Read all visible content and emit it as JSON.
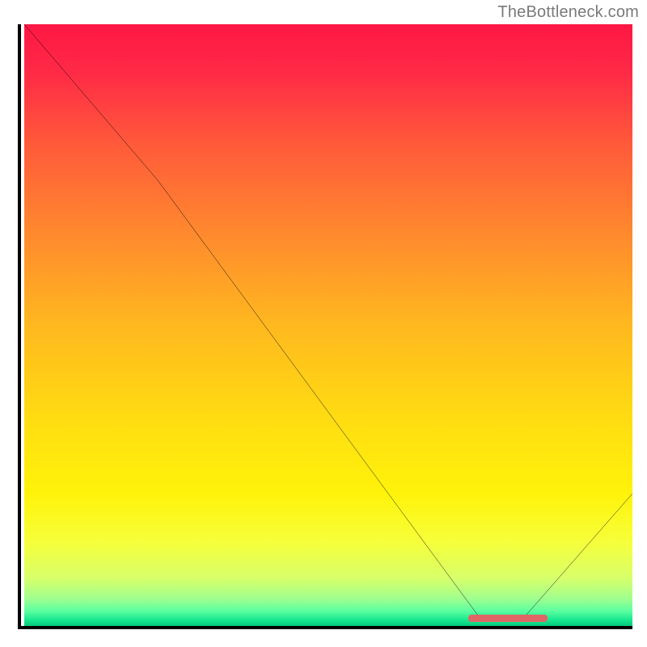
{
  "attribution": "TheBottleneck.com",
  "chart_data": {
    "type": "line",
    "title": "",
    "xlabel": "",
    "ylabel": "",
    "xlim": [
      0,
      100
    ],
    "ylim": [
      0,
      100
    ],
    "x": [
      0,
      22,
      75,
      82,
      100
    ],
    "values": [
      100,
      74,
      1.2,
      1.2,
      22
    ],
    "optimal_range_x": [
      73,
      86
    ],
    "optimal_range_y": 1.4,
    "gradient_stops": [
      {
        "pos": 0.0,
        "color": "#ff1744"
      },
      {
        "pos": 0.5,
        "color": "#ffd200"
      },
      {
        "pos": 0.85,
        "color": "#fff30a"
      },
      {
        "pos": 1.0,
        "color": "#00c97c"
      }
    ]
  }
}
